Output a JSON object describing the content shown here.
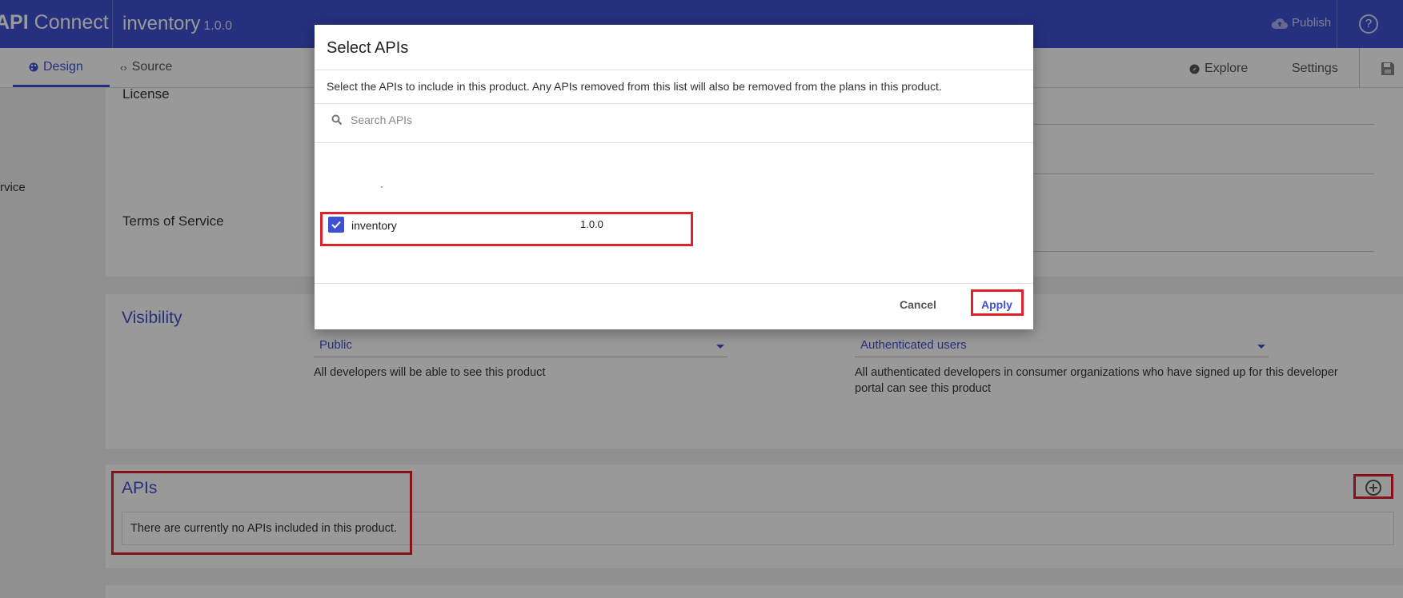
{
  "header": {
    "brand_bold": "API",
    "brand_rest": " Connect",
    "product_name": "inventory",
    "product_version": "1.0.0",
    "publish_label": "Publish"
  },
  "tabs": {
    "design": "Design",
    "source": "Source",
    "explore": "Explore",
    "settings": "Settings"
  },
  "page": {
    "side_label": "rvice",
    "license_label": "License",
    "terms_label": "Terms of Service",
    "visibility": {
      "title": "Visibility",
      "visible_select": "Public",
      "visible_desc": "All developers will be able to see this product",
      "subscribe_select": "Authenticated users",
      "subscribe_desc": "All authenticated developers in consumer organizations who have signed up for this developer portal can see this product"
    },
    "apis": {
      "title": "APIs",
      "empty_text": "There are currently no APIs included in this product."
    }
  },
  "modal": {
    "title": "Select APIs",
    "description": "Select the APIs to include in this product. Any APIs removed from this list will also be removed from the plans in this product.",
    "search_placeholder": "Search APIs",
    "items": [
      {
        "name": "inventory",
        "version": "1.0.0",
        "checked": true
      }
    ],
    "cancel_label": "Cancel",
    "apply_label": "Apply"
  },
  "colors": {
    "brand": "#3f51d2",
    "highlight": "#e0202a"
  },
  "icons": [
    "palette-icon",
    "code-icon",
    "cloud-upload-icon",
    "help-icon",
    "compass-icon",
    "save-icon",
    "search-icon",
    "check-icon",
    "add-circle-icon"
  ]
}
